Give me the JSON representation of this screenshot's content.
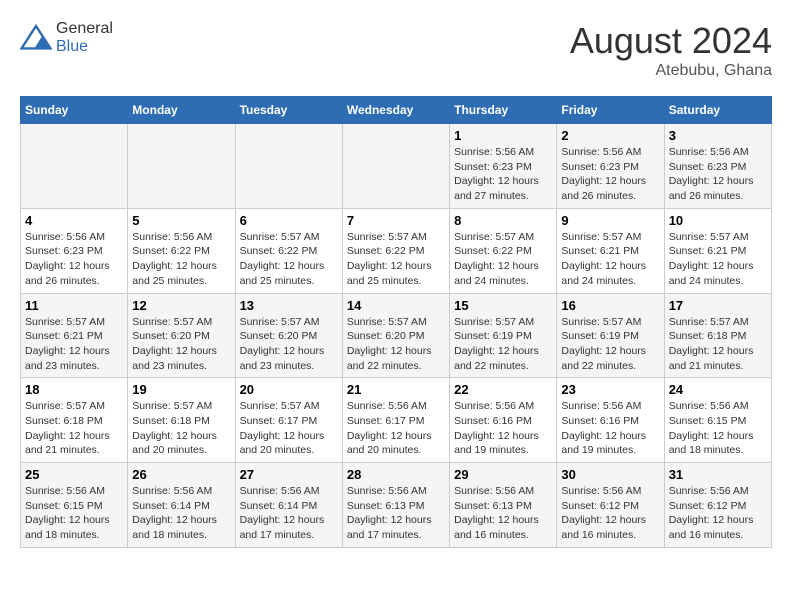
{
  "header": {
    "logo_general": "General",
    "logo_blue": "Blue",
    "month_year": "August 2024",
    "location": "Atebubu, Ghana"
  },
  "columns": [
    "Sunday",
    "Monday",
    "Tuesday",
    "Wednesday",
    "Thursday",
    "Friday",
    "Saturday"
  ],
  "weeks": [
    [
      {
        "day": "",
        "info": ""
      },
      {
        "day": "",
        "info": ""
      },
      {
        "day": "",
        "info": ""
      },
      {
        "day": "",
        "info": ""
      },
      {
        "day": "1",
        "info": "Sunrise: 5:56 AM\nSunset: 6:23 PM\nDaylight: 12 hours\nand 27 minutes."
      },
      {
        "day": "2",
        "info": "Sunrise: 5:56 AM\nSunset: 6:23 PM\nDaylight: 12 hours\nand 26 minutes."
      },
      {
        "day": "3",
        "info": "Sunrise: 5:56 AM\nSunset: 6:23 PM\nDaylight: 12 hours\nand 26 minutes."
      }
    ],
    [
      {
        "day": "4",
        "info": "Sunrise: 5:56 AM\nSunset: 6:23 PM\nDaylight: 12 hours\nand 26 minutes."
      },
      {
        "day": "5",
        "info": "Sunrise: 5:56 AM\nSunset: 6:22 PM\nDaylight: 12 hours\nand 25 minutes."
      },
      {
        "day": "6",
        "info": "Sunrise: 5:57 AM\nSunset: 6:22 PM\nDaylight: 12 hours\nand 25 minutes."
      },
      {
        "day": "7",
        "info": "Sunrise: 5:57 AM\nSunset: 6:22 PM\nDaylight: 12 hours\nand 25 minutes."
      },
      {
        "day": "8",
        "info": "Sunrise: 5:57 AM\nSunset: 6:22 PM\nDaylight: 12 hours\nand 24 minutes."
      },
      {
        "day": "9",
        "info": "Sunrise: 5:57 AM\nSunset: 6:21 PM\nDaylight: 12 hours\nand 24 minutes."
      },
      {
        "day": "10",
        "info": "Sunrise: 5:57 AM\nSunset: 6:21 PM\nDaylight: 12 hours\nand 24 minutes."
      }
    ],
    [
      {
        "day": "11",
        "info": "Sunrise: 5:57 AM\nSunset: 6:21 PM\nDaylight: 12 hours\nand 23 minutes."
      },
      {
        "day": "12",
        "info": "Sunrise: 5:57 AM\nSunset: 6:20 PM\nDaylight: 12 hours\nand 23 minutes."
      },
      {
        "day": "13",
        "info": "Sunrise: 5:57 AM\nSunset: 6:20 PM\nDaylight: 12 hours\nand 23 minutes."
      },
      {
        "day": "14",
        "info": "Sunrise: 5:57 AM\nSunset: 6:20 PM\nDaylight: 12 hours\nand 22 minutes."
      },
      {
        "day": "15",
        "info": "Sunrise: 5:57 AM\nSunset: 6:19 PM\nDaylight: 12 hours\nand 22 minutes."
      },
      {
        "day": "16",
        "info": "Sunrise: 5:57 AM\nSunset: 6:19 PM\nDaylight: 12 hours\nand 22 minutes."
      },
      {
        "day": "17",
        "info": "Sunrise: 5:57 AM\nSunset: 6:18 PM\nDaylight: 12 hours\nand 21 minutes."
      }
    ],
    [
      {
        "day": "18",
        "info": "Sunrise: 5:57 AM\nSunset: 6:18 PM\nDaylight: 12 hours\nand 21 minutes."
      },
      {
        "day": "19",
        "info": "Sunrise: 5:57 AM\nSunset: 6:18 PM\nDaylight: 12 hours\nand 20 minutes."
      },
      {
        "day": "20",
        "info": "Sunrise: 5:57 AM\nSunset: 6:17 PM\nDaylight: 12 hours\nand 20 minutes."
      },
      {
        "day": "21",
        "info": "Sunrise: 5:56 AM\nSunset: 6:17 PM\nDaylight: 12 hours\nand 20 minutes."
      },
      {
        "day": "22",
        "info": "Sunrise: 5:56 AM\nSunset: 6:16 PM\nDaylight: 12 hours\nand 19 minutes."
      },
      {
        "day": "23",
        "info": "Sunrise: 5:56 AM\nSunset: 6:16 PM\nDaylight: 12 hours\nand 19 minutes."
      },
      {
        "day": "24",
        "info": "Sunrise: 5:56 AM\nSunset: 6:15 PM\nDaylight: 12 hours\nand 18 minutes."
      }
    ],
    [
      {
        "day": "25",
        "info": "Sunrise: 5:56 AM\nSunset: 6:15 PM\nDaylight: 12 hours\nand 18 minutes."
      },
      {
        "day": "26",
        "info": "Sunrise: 5:56 AM\nSunset: 6:14 PM\nDaylight: 12 hours\nand 18 minutes."
      },
      {
        "day": "27",
        "info": "Sunrise: 5:56 AM\nSunset: 6:14 PM\nDaylight: 12 hours\nand 17 minutes."
      },
      {
        "day": "28",
        "info": "Sunrise: 5:56 AM\nSunset: 6:13 PM\nDaylight: 12 hours\nand 17 minutes."
      },
      {
        "day": "29",
        "info": "Sunrise: 5:56 AM\nSunset: 6:13 PM\nDaylight: 12 hours\nand 16 minutes."
      },
      {
        "day": "30",
        "info": "Sunrise: 5:56 AM\nSunset: 6:12 PM\nDaylight: 12 hours\nand 16 minutes."
      },
      {
        "day": "31",
        "info": "Sunrise: 5:56 AM\nSunset: 6:12 PM\nDaylight: 12 hours\nand 16 minutes."
      }
    ]
  ]
}
